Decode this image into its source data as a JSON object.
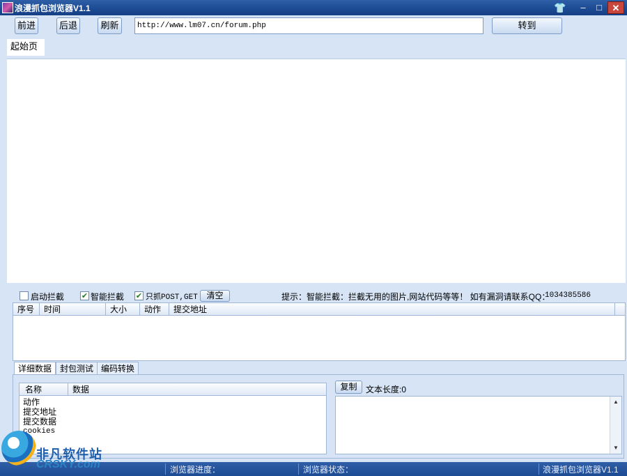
{
  "window": {
    "title": "浪漫抓包浏览器V1.1"
  },
  "toolbar": {
    "forward_label": "前进",
    "back_label": "后退",
    "refresh_label": "刷新",
    "url": "http://www.lm07.cn/forum.php",
    "go_label": "转到"
  },
  "tabs": {
    "start_page": "起始页"
  },
  "capture": {
    "enable_label": "启动拦截",
    "enable_checked": false,
    "smart_label": "智能拦截",
    "smart_checked": true,
    "postget_label": "只抓POST,GET",
    "postget_checked": true,
    "clear_label": "清空",
    "hint": "提示：智能拦截：拦截无用的图片,网站代码等等！  如有漏洞请联系QQ：",
    "qq": "1034385586"
  },
  "packet_table": {
    "columns": [
      "序号",
      "时间",
      "大小",
      "动作",
      "提交地址"
    ]
  },
  "detail_tabs": [
    "详细数据",
    "封包测试",
    "编码转换"
  ],
  "detail_table": {
    "columns": [
      "名称",
      "数据"
    ],
    "rows": [
      "动作",
      "提交地址",
      "提交数据",
      "cookies"
    ]
  },
  "copy": {
    "label": "复制",
    "length_text": "文本长度:0"
  },
  "statusbar": {
    "progress_label": "浏览器进度：",
    "state_label": "浏览器状态：",
    "app_name": "浪漫抓包浏览器V1.1"
  },
  "watermark": {
    "line1": "非凡软件站",
    "line2": "CRSKY.com"
  },
  "colors": {
    "titlebar": "#1b4a93",
    "window_bg": "#d6e4f5",
    "close": "#c9463d"
  }
}
